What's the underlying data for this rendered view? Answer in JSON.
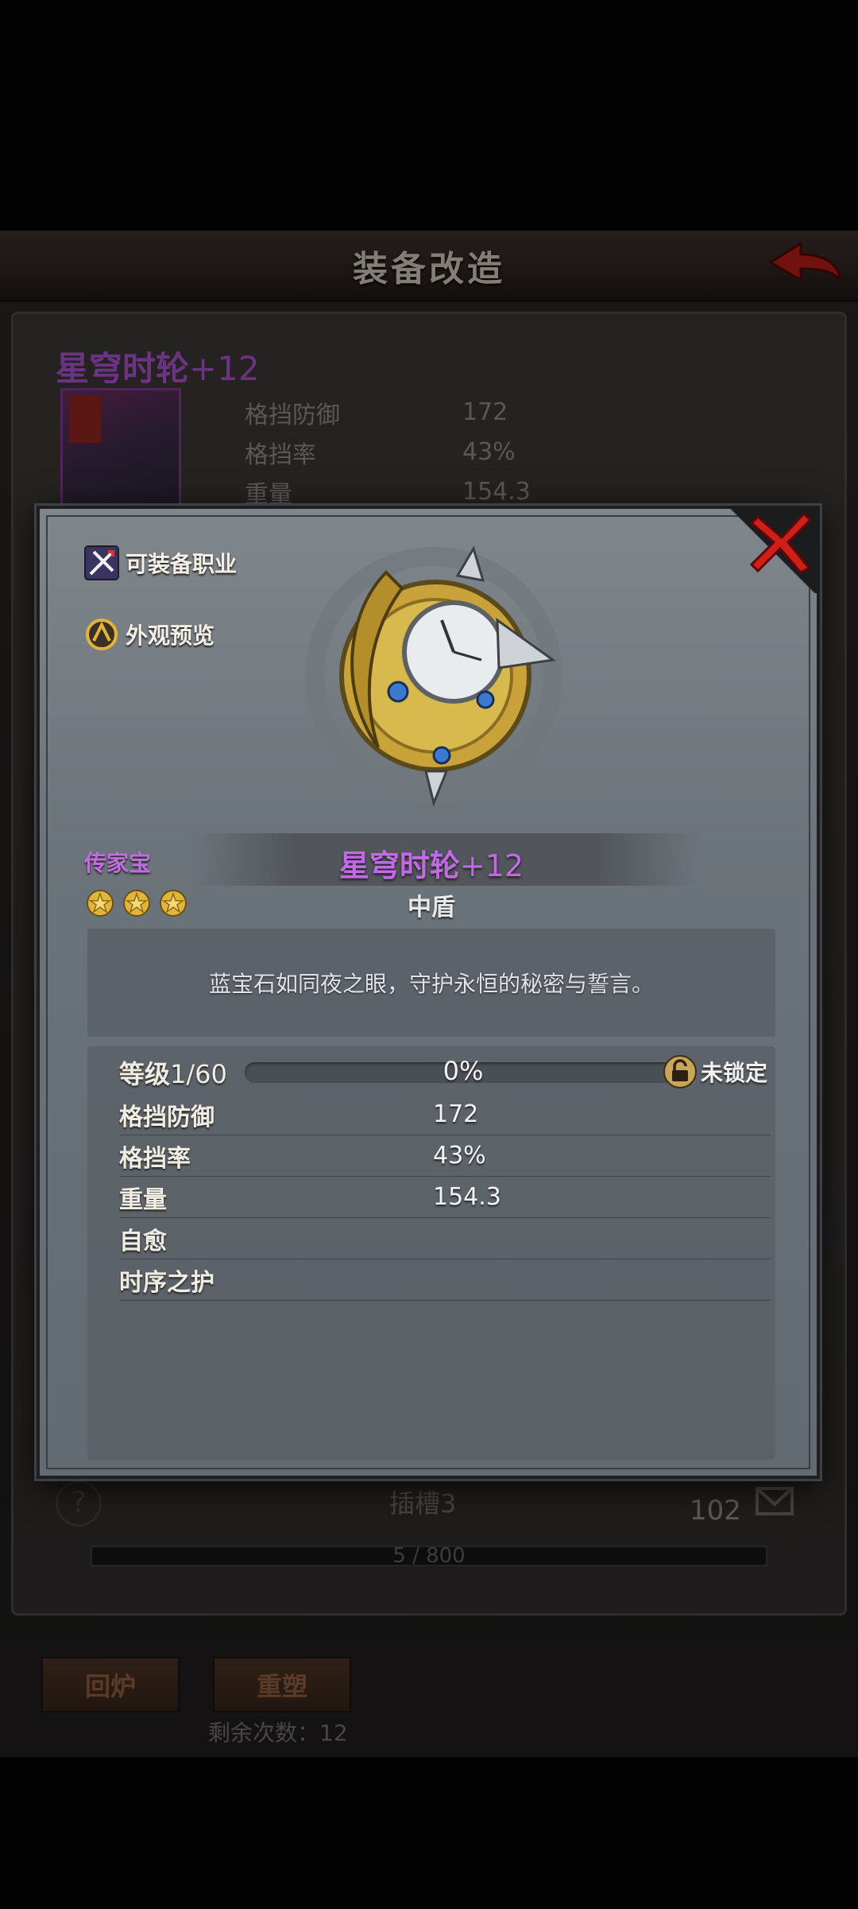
{
  "screen": {
    "title": "装备改造",
    "item_name": "星穹时轮",
    "item_plus": "+12",
    "stats": [
      {
        "label": "格挡防御",
        "value": "172"
      },
      {
        "label": "格挡率",
        "value": "43%"
      },
      {
        "label": "重量",
        "value": "154.3"
      }
    ],
    "slot_label": "插槽3",
    "slot_count": "102",
    "progress_text": "5 / 800",
    "recycle_label": "回炉",
    "reshape_label": "重塑",
    "remaining_label": "剩余次数：12"
  },
  "modal": {
    "equip_class_label": "可装备职业",
    "appearance_label": "外观预览",
    "rarity": "传家宝",
    "item_name": "星穹时轮",
    "item_plus": "+12",
    "item_type": "中盾",
    "star_count": 3,
    "description": "蓝宝石如同夜之眼，守护永恒的秘密与誓言。",
    "level_label": "等级",
    "level_value": "1/60",
    "level_progress": 0,
    "level_progress_text": "0%",
    "lock_label": "未锁定",
    "stats": [
      {
        "label": "格挡防御",
        "value": "172"
      },
      {
        "label": "格挡率",
        "value": "43%"
      },
      {
        "label": "重量",
        "value": "154.3"
      },
      {
        "label": "自愈",
        "value": ""
      },
      {
        "label": "时序之护",
        "value": ""
      }
    ]
  },
  "colors": {
    "rarity_purple": "#c26ae6",
    "gold": "#e1b43a"
  },
  "icons": [
    "back-arrow-icon",
    "close-icon",
    "equip-class-icon",
    "appearance-icon",
    "star-icon",
    "lock-icon",
    "help-icon",
    "mail-icon"
  ]
}
